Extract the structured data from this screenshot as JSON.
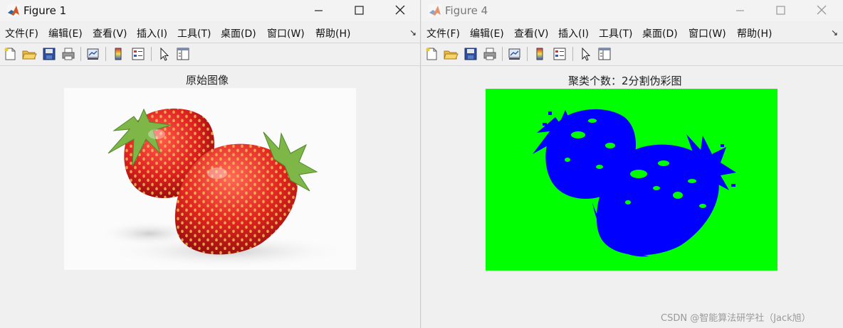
{
  "windows": [
    {
      "title": "Figure 1",
      "menu": [
        "文件(F)",
        "编辑(E)",
        "查看(V)",
        "插入(I)",
        "工具(T)",
        "桌面(D)",
        "窗口(W)",
        "帮助(H)"
      ],
      "menu_overflow": "↘",
      "toolbar_icons": [
        "new-figure-icon",
        "open-file-icon",
        "save-icon",
        "print-icon",
        "link-plot-icon",
        "colorbar-icon",
        "legend-icon",
        "pointer-icon",
        "property-inspector-icon"
      ],
      "axes_title": "原始图像",
      "image": "strawberries-photo"
    },
    {
      "title": "Figure 4",
      "menu": [
        "文件(F)",
        "编辑(E)",
        "查看(V)",
        "插入(I)",
        "工具(T)",
        "桌面(D)",
        "窗口(W)",
        "帮助(H)"
      ],
      "menu_overflow": "↘",
      "toolbar_icons": [
        "new-figure-icon",
        "open-file-icon",
        "save-icon",
        "print-icon",
        "link-plot-icon",
        "colorbar-icon",
        "legend-icon",
        "pointer-icon",
        "property-inspector-icon"
      ],
      "axes_title": "聚类个数：2分割伪彩图",
      "image": "pseudocolor-segmentation",
      "colors": {
        "background_cluster": "#00ff00",
        "object_cluster": "#0000ff"
      }
    }
  ],
  "watermark": "CSDN @智能算法研学社（Jack旭）"
}
